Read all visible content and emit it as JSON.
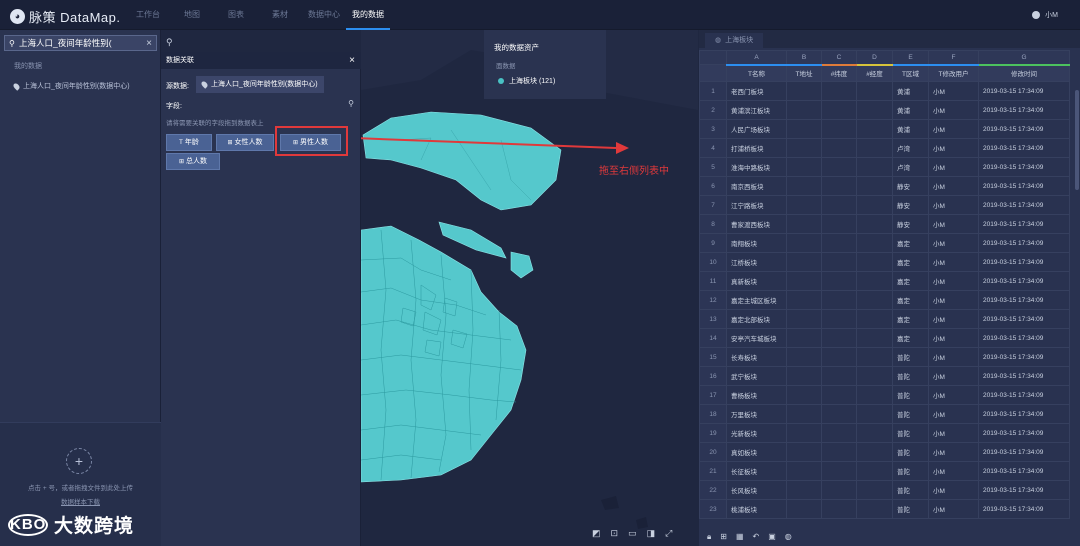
{
  "app": {
    "logo_text": "脉策 DataMap.",
    "user": "小M"
  },
  "nav": {
    "items": [
      "工作台",
      "地图",
      "图表",
      "素材",
      "数据中心",
      "我的数据"
    ],
    "active": 5
  },
  "sidebar": {
    "search_value": "上海人口_夜间年龄性别(",
    "section_label": "我的数据",
    "dataset": "上海人口_夜间年龄性别(数据中心)",
    "upload_hint": "点击 + 号，或者拖拽文件到此处上传",
    "download_link": "数据样本下载"
  },
  "watermark": {
    "logo": "KBO",
    "text": "大数跨境"
  },
  "link_panel": {
    "title": "数据关联",
    "source_label": "源数据:",
    "source_value": "上海人口_夜间年龄性别(数据中心)",
    "field_label": "字段:",
    "field_hint": "请将需要关联的字段拖到数据表上",
    "chips": [
      "年龄",
      "女性人数",
      "男性人数",
      "总人数"
    ]
  },
  "assets": {
    "title": "我的数据资产",
    "sub": "面数据",
    "item": "上海板块 (121)"
  },
  "annotation": "拖至右侧列表中",
  "sheet": {
    "tab": "上海板块",
    "columns": [
      "A",
      "B",
      "C",
      "D",
      "E",
      "F",
      "G"
    ],
    "headers": [
      "T名称",
      "T地址",
      "#纬度",
      "#经度",
      "T区域",
      "T修改用户",
      "修改时间"
    ],
    "header_colors": [
      "#2c8ef0",
      "#2c8ef0",
      "#e07b39",
      "#d6c33b",
      "#2c8ef0",
      "#2c8ef0",
      "#4cc25e"
    ],
    "rows": [
      {
        "n": "1",
        "name": "老西门板块",
        "area": "黄浦",
        "user": "小M",
        "time": "2019-03-15 17:34:09"
      },
      {
        "n": "2",
        "name": "黄浦滨江板块",
        "area": "黄浦",
        "user": "小M",
        "time": "2019-03-15 17:34:09"
      },
      {
        "n": "3",
        "name": "人民广场板块",
        "area": "黄浦",
        "user": "小M",
        "time": "2019-03-15 17:34:09"
      },
      {
        "n": "4",
        "name": "打浦桥板块",
        "area": "卢湾",
        "user": "小M",
        "time": "2019-03-15 17:34:09"
      },
      {
        "n": "5",
        "name": "淮海中路板块",
        "area": "卢湾",
        "user": "小M",
        "time": "2019-03-15 17:34:09"
      },
      {
        "n": "6",
        "name": "南京西板块",
        "area": "静安",
        "user": "小M",
        "time": "2019-03-15 17:34:09"
      },
      {
        "n": "7",
        "name": "江宁路板块",
        "area": "静安",
        "user": "小M",
        "time": "2019-03-15 17:34:09"
      },
      {
        "n": "8",
        "name": "曹家渡西板块",
        "area": "静安",
        "user": "小M",
        "time": "2019-03-15 17:34:09"
      },
      {
        "n": "9",
        "name": "南翔板块",
        "area": "嘉定",
        "user": "小M",
        "time": "2019-03-15 17:34:09"
      },
      {
        "n": "10",
        "name": "江桥板块",
        "area": "嘉定",
        "user": "小M",
        "time": "2019-03-15 17:34:09"
      },
      {
        "n": "11",
        "name": "真新板块",
        "area": "嘉定",
        "user": "小M",
        "time": "2019-03-15 17:34:09"
      },
      {
        "n": "12",
        "name": "嘉定主城区板块",
        "area": "嘉定",
        "user": "小M",
        "time": "2019-03-15 17:34:09"
      },
      {
        "n": "13",
        "name": "嘉定北部板块",
        "area": "嘉定",
        "user": "小M",
        "time": "2019-03-15 17:34:09"
      },
      {
        "n": "14",
        "name": "安亭汽车城板块",
        "area": "嘉定",
        "user": "小M",
        "time": "2019-03-15 17:34:09"
      },
      {
        "n": "15",
        "name": "长寿板块",
        "area": "普陀",
        "user": "小M",
        "time": "2019-03-15 17:34:09"
      },
      {
        "n": "16",
        "name": "武宁板块",
        "area": "普陀",
        "user": "小M",
        "time": "2019-03-15 17:34:09"
      },
      {
        "n": "17",
        "name": "曹杨板块",
        "area": "普陀",
        "user": "小M",
        "time": "2019-03-15 17:34:09"
      },
      {
        "n": "18",
        "name": "万里板块",
        "area": "普陀",
        "user": "小M",
        "time": "2019-03-15 17:34:09"
      },
      {
        "n": "19",
        "name": "光新板块",
        "area": "普陀",
        "user": "小M",
        "time": "2019-03-15 17:34:09"
      },
      {
        "n": "20",
        "name": "真如板块",
        "area": "普陀",
        "user": "小M",
        "time": "2019-03-15 17:34:09"
      },
      {
        "n": "21",
        "name": "长征板块",
        "area": "普陀",
        "user": "小M",
        "time": "2019-03-15 17:34:09"
      },
      {
        "n": "22",
        "name": "长风板块",
        "area": "普陀",
        "user": "小M",
        "time": "2019-03-15 17:34:09"
      },
      {
        "n": "23",
        "name": "桃浦板块",
        "area": "普陀",
        "user": "小M",
        "time": "2019-03-15 17:34:09"
      }
    ]
  },
  "colors": {
    "accent": "#2c8ef0",
    "region_fill": "#55c8cc",
    "annotation": "#e0393b"
  }
}
